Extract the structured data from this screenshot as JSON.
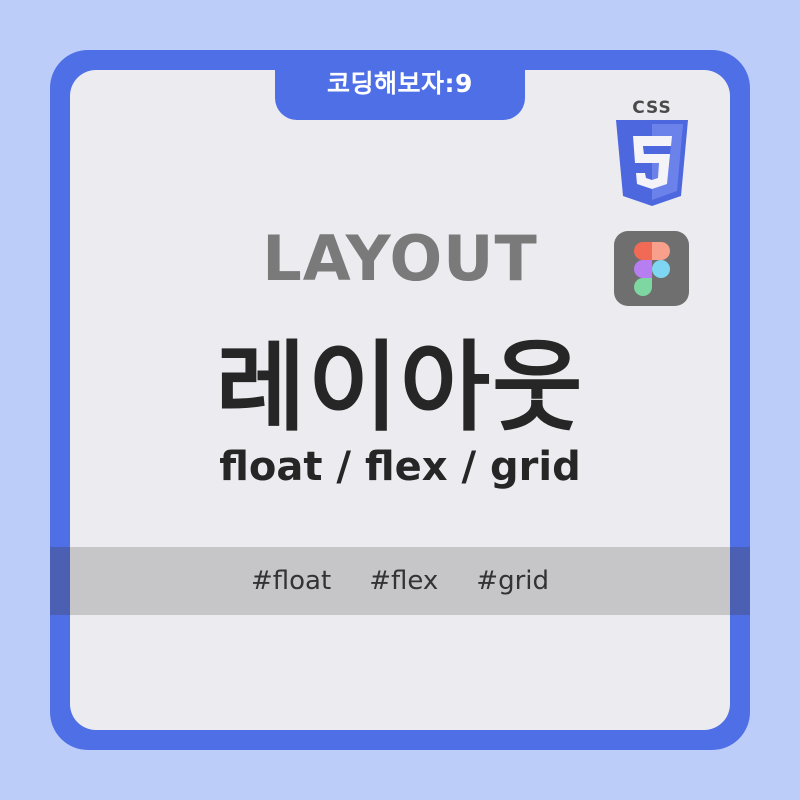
{
  "badge": {
    "text": "코딩해보자:9"
  },
  "title": {
    "english": "LAYOUT",
    "korean": "레이아웃"
  },
  "keywords": "float / flex / grid",
  "hashtags": [
    "#float",
    "#flex",
    "#grid"
  ],
  "logos": {
    "css_label": "CSS",
    "css_icon": "css3-icon",
    "figma_icon": "figma-icon"
  },
  "colors": {
    "background": "#bccdf9",
    "frame": "#4f6fe6",
    "card": "#ececf0",
    "band": "#c6c6c8",
    "title": "#262626",
    "subtitle": "#7a7a7a"
  }
}
